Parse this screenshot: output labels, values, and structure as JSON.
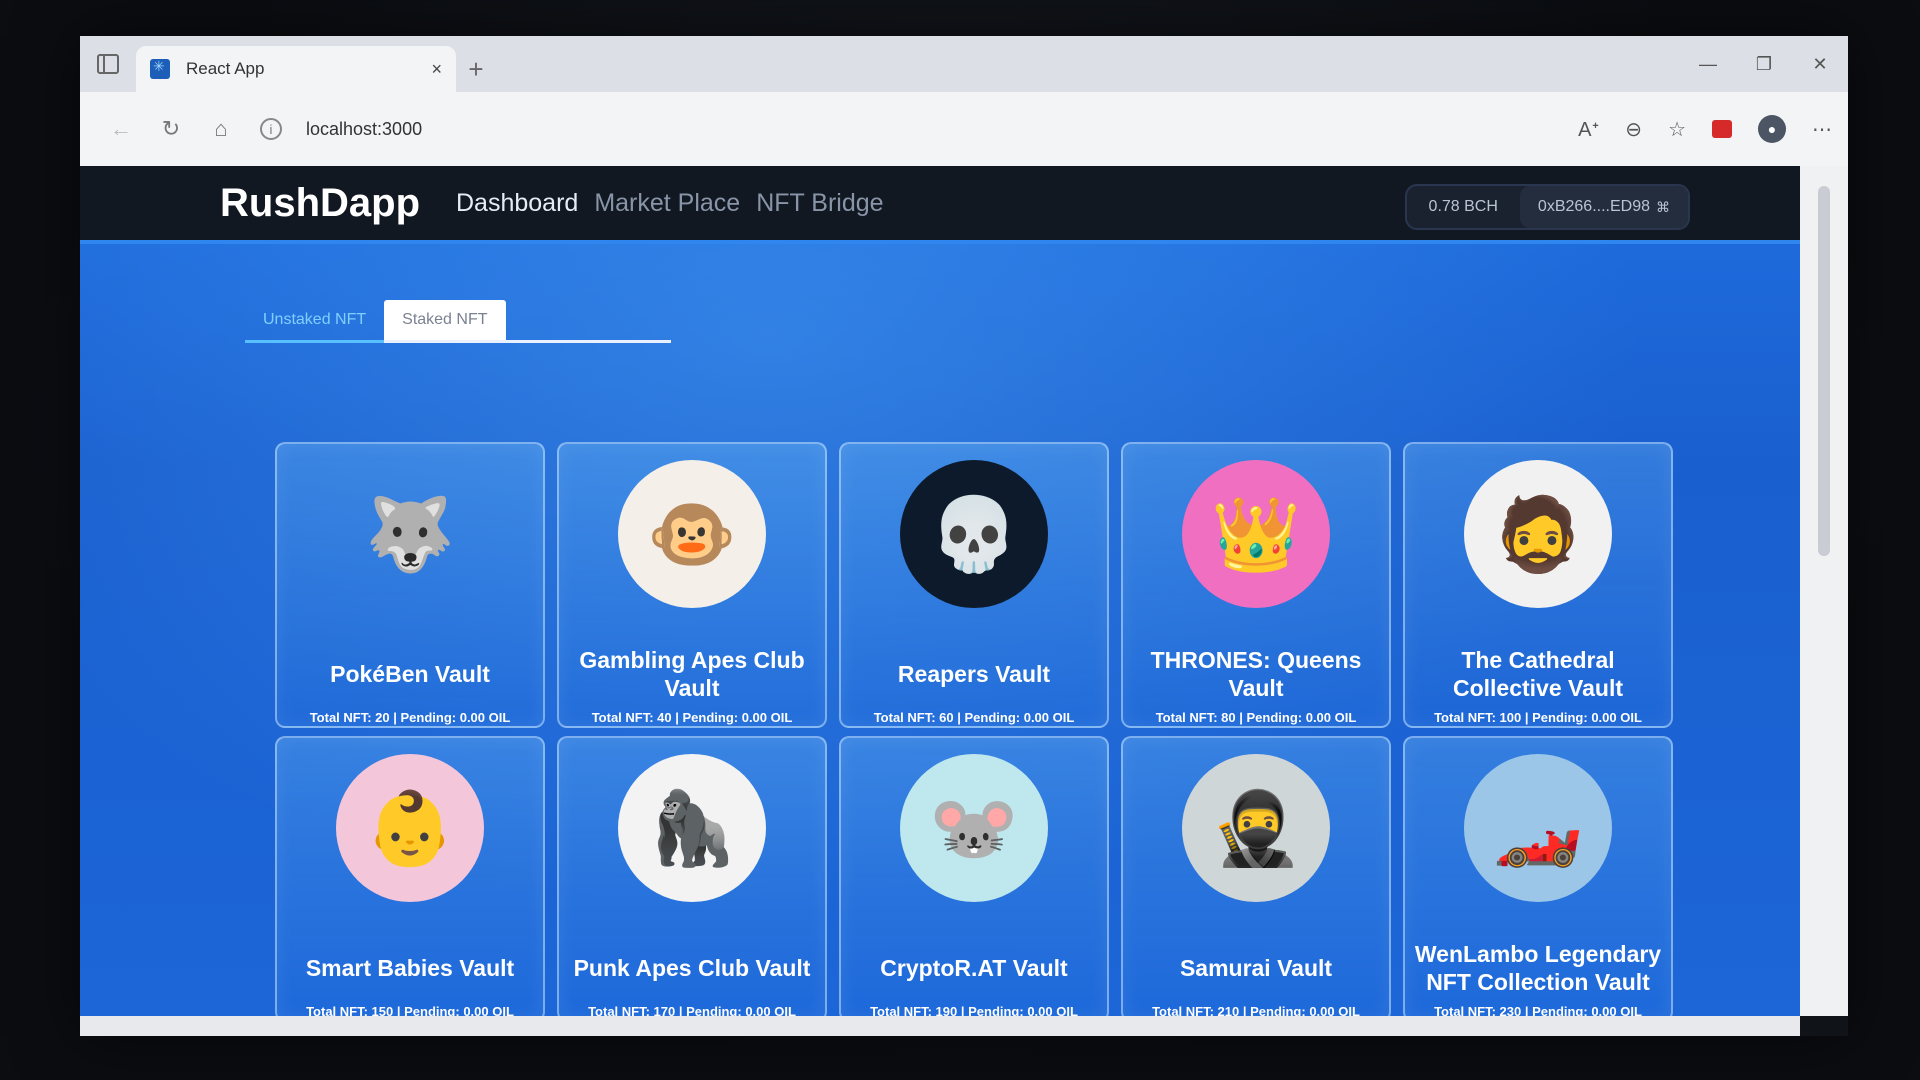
{
  "browser": {
    "tab_title": "React App",
    "tab_close": "×",
    "new_tab": "+",
    "url": "localhost:3000",
    "icons": [
      "back-icon",
      "refresh-icon",
      "home-icon",
      "info-icon",
      "read-aloud-icon",
      "zoom-icon",
      "favorite-icon",
      "extension-icon",
      "profile-icon",
      "more-icon"
    ]
  },
  "navbar": {
    "brand": "RushDapp",
    "links": [
      "Dashboard",
      "Market Place",
      "NFT Bridge"
    ],
    "active_link": "Dashboard"
  },
  "wallet": {
    "balance": "0.78 BCH",
    "address": "0xB266....ED98"
  },
  "tabs": {
    "unstaked": "Unstaked NFT",
    "staked": "Staked NFT",
    "active": "Unstaked NFT"
  },
  "vaults": [
    {
      "name": "PokéBen Vault",
      "meta": "Total NFT: 20 | Pending: 0.00 OIL"
    },
    {
      "name": "Gambling Apes Club Vault",
      "meta": "Total NFT: 40 | Pending: 0.00 OIL"
    },
    {
      "name": "Reapers Vault",
      "meta": "Total NFT: 60 | Pending: 0.00 OIL"
    },
    {
      "name": "THRONES: Queens Vault",
      "meta": "Total NFT: 80 | Pending: 0.00 OIL"
    },
    {
      "name": "The Cathedral Collective Vault",
      "meta": "Total NFT: 100 | Pending: 0.00 OIL"
    },
    {
      "name": "Smart Babies Vault",
      "meta": "Total NFT: 150 | Pending: 0.00 OIL"
    },
    {
      "name": "Punk Apes Club Vault",
      "meta": "Total NFT: 170 | Pending: 0.00 OIL"
    },
    {
      "name": "CryptoR.AT Vault",
      "meta": "Total NFT: 190 | Pending: 0.00 OIL"
    },
    {
      "name": "Samurai Vault",
      "meta": "Total NFT: 210 | Pending: 0.00 OIL"
    },
    {
      "name": "WenLambo Legendary NFT Collection Vault",
      "meta": "Total NFT: 230 | Pending: 0.00 OIL"
    }
  ],
  "colors": {
    "accent": "#2f86ee",
    "navbar_bg": "#121821",
    "page_bg": "#1c66d8"
  }
}
